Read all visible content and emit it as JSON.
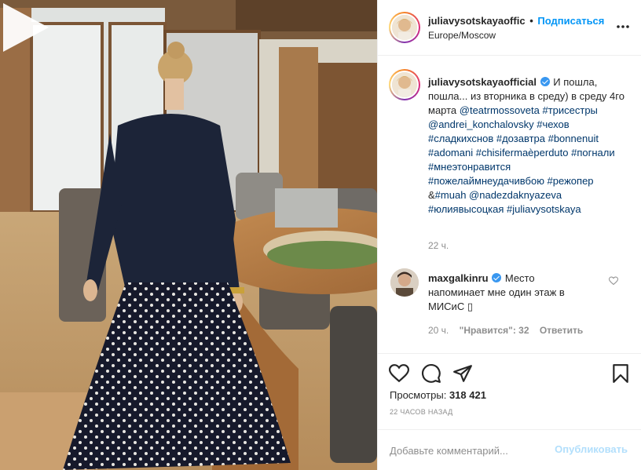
{
  "post": {
    "author": "juliavysotskayaoffic",
    "follow_label": "Подписаться",
    "dot": "•",
    "location": "Europe/Moscow"
  },
  "caption": {
    "username": "juliavysotskayaofficial",
    "text_1": " И пошла, пошла... из вторника в среду) в среду 4го марта ",
    "mention_1": "@teatrmossoveta",
    "tags_1": "#трисестры",
    "mention_2": "@andrei_konchalovsky",
    "tags_2": "#чехов #сладкихснов #дозавтра #bonnenuit #adomani #chisifermaèperduto #погнали #мнеэтонравится #пожелаймнеудачивбою #режопер",
    "text_2": "&",
    "tags_3": "#muah",
    "mention_3": "@nadezdaknyazeva",
    "tags_4": "#юлиявысоцкая #juliavysotskaya",
    "time": "22 ч."
  },
  "comment": {
    "username": "maxgalkinru",
    "text": "Место напоминает мне один этаж в МИСиС ▯",
    "time": "20 ч.",
    "likes": "\"Нравится\": 32",
    "reply": "Ответить"
  },
  "stats": {
    "views_label": "Просмотры:",
    "views_count": "318 421",
    "posted": "22 часов назад"
  },
  "add_comment": {
    "placeholder": "Добавьте комментарий...",
    "publish": "Опубликовать"
  },
  "colors": {
    "link": "#00376b",
    "accent": "#0095f6",
    "verified": "#3897f0",
    "muted": "#8e8e8e"
  },
  "icons": [
    "play-icon",
    "more-icon",
    "verified-icon",
    "heart-icon",
    "comment-icon",
    "share-icon",
    "bookmark-icon"
  ]
}
